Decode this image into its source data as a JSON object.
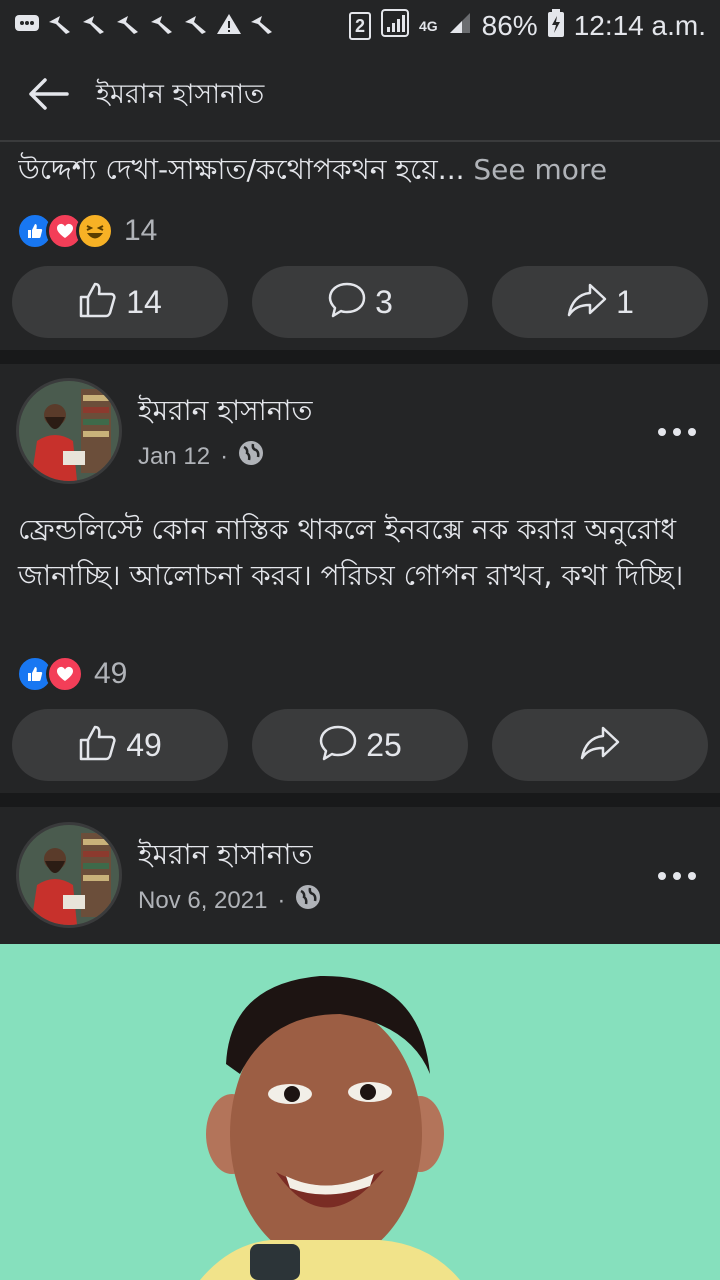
{
  "status_bar": {
    "sim_badge": "2",
    "network": "4G",
    "battery": "86%",
    "time": "12:14 a.m."
  },
  "header": {
    "title": "ইমরান হাসানাত"
  },
  "post_partial": {
    "text": "উদ্দেশ্য দেখা-সাক্ষাত/কথোপকথন হয়ে...",
    "see_more": "See more",
    "reaction_count": "14",
    "like_count": "14",
    "comment_count": "3",
    "share_count": "1"
  },
  "post_2": {
    "author": "ইমরান হাসানাত",
    "date": "Jan 12",
    "separator": "·",
    "text": "ফ্রেন্ডলিস্টে কোন নাস্তিক থাকলে ইনবক্সে নক করার অনুরোধ জানাচ্ছি। আলোচনা করব। পরিচয় গোপন রাখব, কথা দিচ্ছি।",
    "reaction_count": "49",
    "like_count": "49",
    "comment_count": "25"
  },
  "post_3": {
    "author": "ইমরান হাসানাত",
    "date": "Nov 6, 2021",
    "separator": "·"
  },
  "colors": {
    "background": "#242526",
    "button": "#3a3b3c",
    "like_blue": "#1877f2",
    "love_red": "#f33e58",
    "haha_yellow": "#f7b125"
  }
}
